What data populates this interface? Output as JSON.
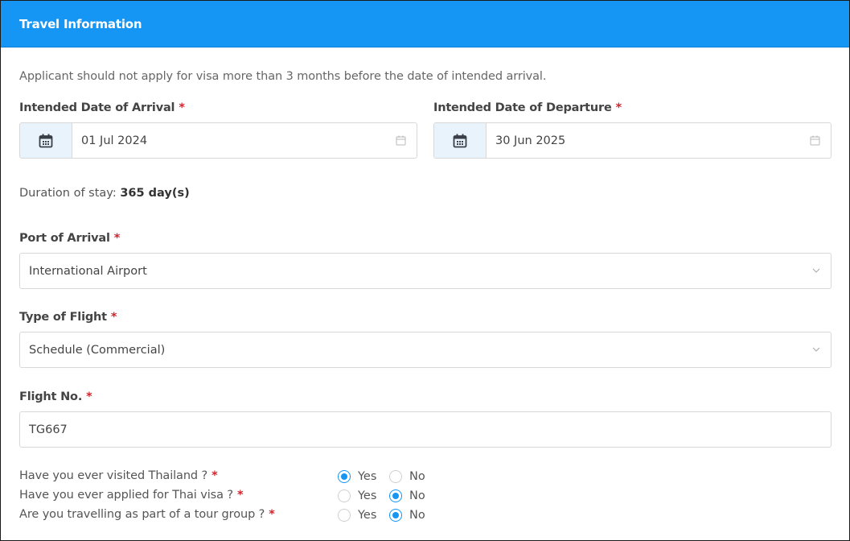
{
  "header": {
    "title": "Travel Information"
  },
  "note": "Applicant should not apply for visa more than 3 months before the date of intended arrival.",
  "required_mark": "*",
  "arrival": {
    "label": "Intended Date of Arrival",
    "value": "01 Jul 2024"
  },
  "departure": {
    "label": "Intended Date of Departure",
    "value": "30 Jun 2025"
  },
  "duration": {
    "label": "Duration of stay:",
    "value": "365 day(s)"
  },
  "port": {
    "label": "Port of Arrival",
    "value": "International Airport"
  },
  "flight_type": {
    "label": "Type of Flight",
    "value": "Schedule (Commercial)"
  },
  "flight_no": {
    "label": "Flight No.",
    "value": "TG667"
  },
  "questions": [
    {
      "text": "Have you ever visited Thailand ?",
      "yes": "Yes",
      "no": "No",
      "selected": "Yes"
    },
    {
      "text": "Have you ever applied for Thai visa ?",
      "yes": "Yes",
      "no": "No",
      "selected": "No"
    },
    {
      "text": "Are you travelling as part of a tour group ?",
      "yes": "Yes",
      "no": "No",
      "selected": "No"
    }
  ],
  "colors": {
    "accent": "#1596f5",
    "required": "#d0252c",
    "addon_bg": "#e9f3fb"
  },
  "icons": {
    "date_addon": "calendar-icon",
    "date_trail": "calendar-outline-icon",
    "select": "chevron-down-icon"
  }
}
